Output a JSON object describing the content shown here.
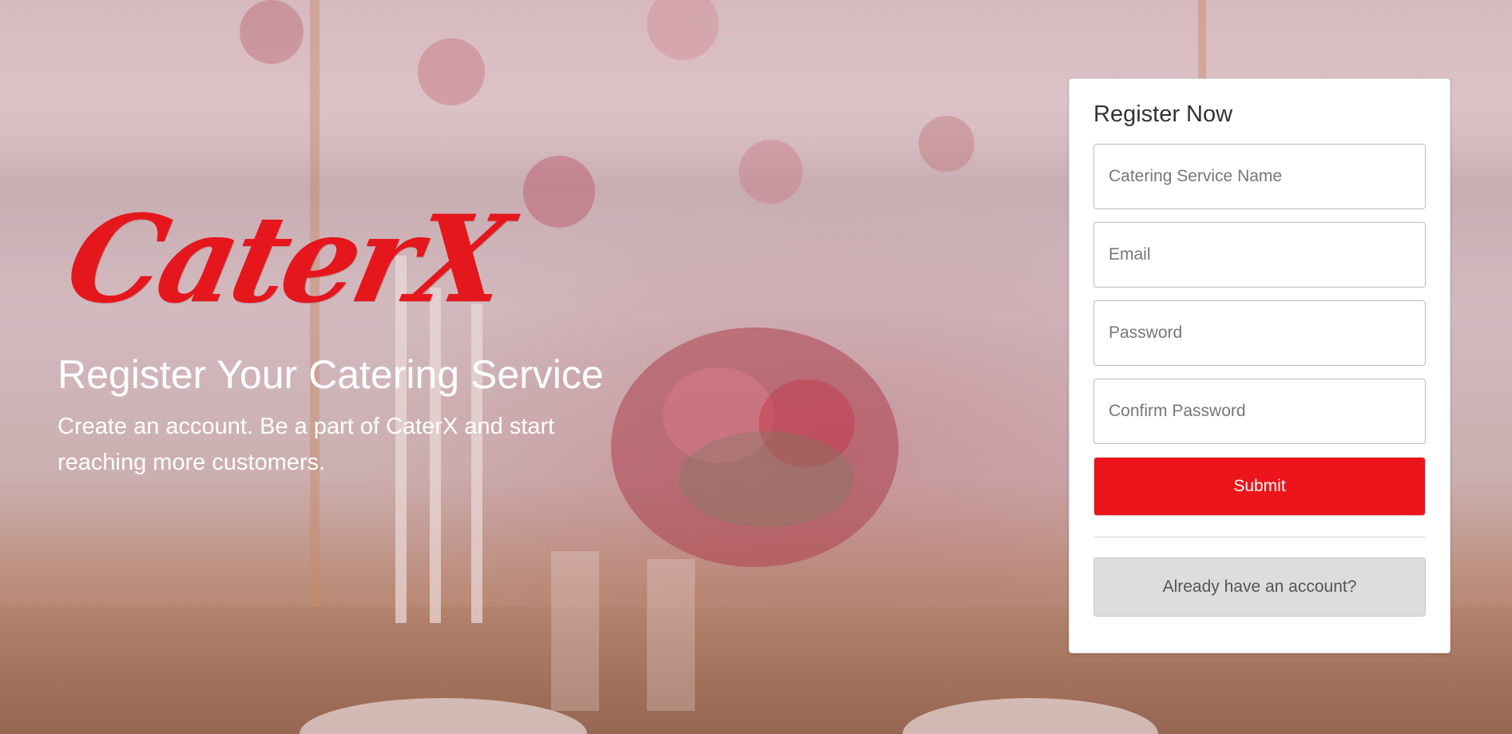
{
  "brand": {
    "logo_text": "CaterX",
    "logo_color": "#e5161c"
  },
  "hero": {
    "title": "Register Your Catering Service",
    "subtitle": "Create an account. Be a part of CaterX and start reaching more customers."
  },
  "register_form": {
    "title": "Register Now",
    "fields": {
      "service_name": {
        "placeholder": "Catering Service Name",
        "value": ""
      },
      "email": {
        "placeholder": "Email",
        "value": ""
      },
      "password": {
        "placeholder": "Password",
        "value": ""
      },
      "confirm_password": {
        "placeholder": "Confirm Password",
        "value": ""
      }
    },
    "submit_label": "Submit",
    "login_label": "Already have an account?"
  },
  "colors": {
    "accent": "#ec151b",
    "secondary_button": "#dddddd",
    "card_background": "#ffffff"
  }
}
